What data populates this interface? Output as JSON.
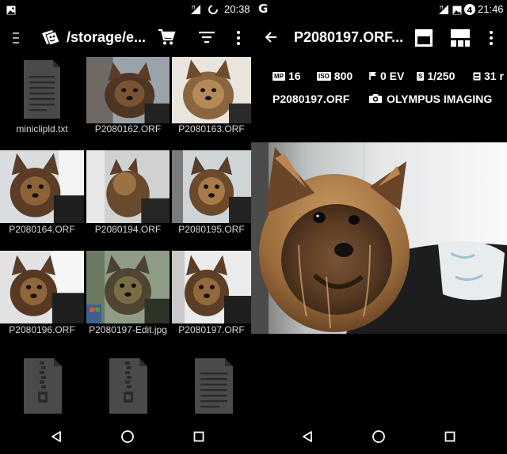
{
  "left": {
    "status": {
      "time": "20:38"
    },
    "appbar": {
      "path": "/storage/e..."
    },
    "grid": [
      {
        "name": "miniclipld.txt",
        "kind": "text-file"
      },
      {
        "name": "P2080162.ORF",
        "kind": "photo"
      },
      {
        "name": "P2080163.ORF",
        "kind": "photo"
      },
      {
        "name": "P2080164.ORF",
        "kind": "photo"
      },
      {
        "name": "P2080194.ORF",
        "kind": "photo"
      },
      {
        "name": "P2080195.ORF",
        "kind": "photo"
      },
      {
        "name": "P2080196.ORF",
        "kind": "photo"
      },
      {
        "name": "P2080197-Edit.jpg",
        "kind": "photo"
      },
      {
        "name": "P2080197.ORF",
        "kind": "photo"
      }
    ],
    "partial_icons": [
      "zip-file-icon",
      "zip-file-icon",
      "text-file-icon"
    ]
  },
  "right": {
    "status": {
      "time": "21:46"
    },
    "appbar": {
      "title": "P2080197.ORF..."
    },
    "exif": {
      "megapixels_badge": "MP",
      "megapixels": "16",
      "iso_badge": "ISO",
      "iso": "800",
      "ev": "0 EV",
      "shutter_badge": "S",
      "shutter": "1/250",
      "focal": "31 r",
      "filename": "P2080197.ORF",
      "camera": "OLYMPUS IMAGING"
    }
  },
  "colors": {
    "background": "#000000",
    "placeholder_icon": "#4a4a4a",
    "caption": "#d8d8d8"
  }
}
